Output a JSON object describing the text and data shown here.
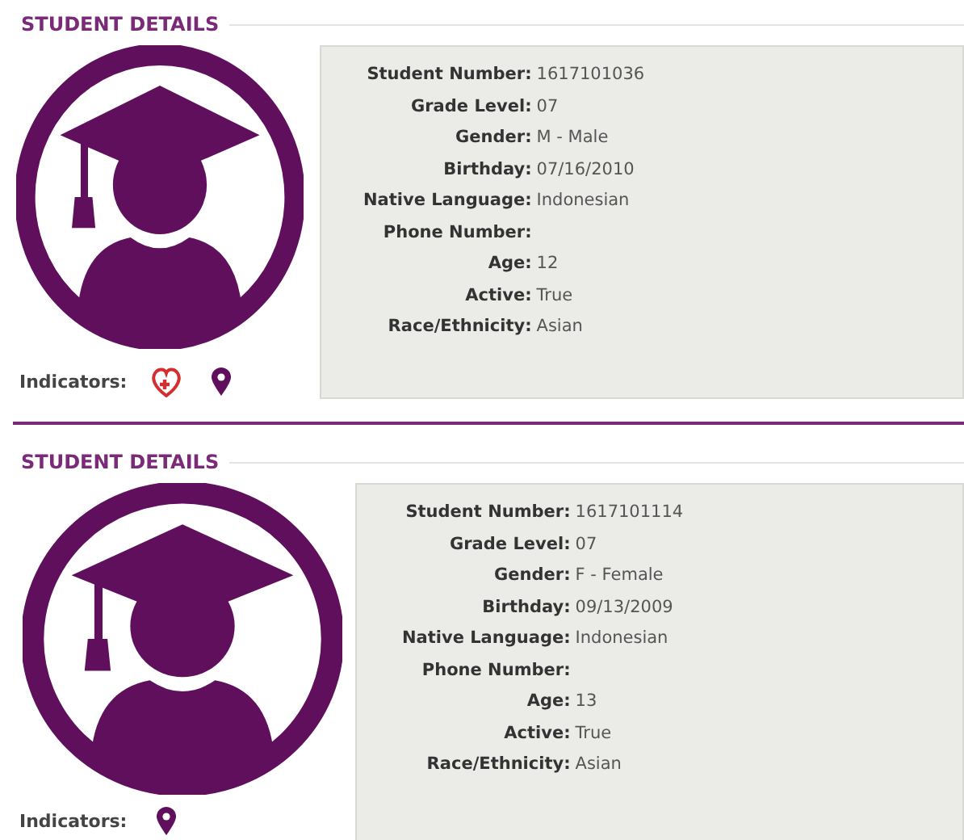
{
  "students": [
    {
      "title": "STUDENT DETAILS",
      "fields": [
        {
          "label": "Student Number:",
          "value": "1617101036"
        },
        {
          "label": "Grade Level:",
          "value": "07"
        },
        {
          "label": "Gender:",
          "value": "M - Male"
        },
        {
          "label": "Birthday:",
          "value": "07/16/2010"
        },
        {
          "label": "Native Language:",
          "value": "Indonesian"
        },
        {
          "label": "Phone Number:"
        },
        {
          "label": "Age:",
          "value": "12"
        },
        {
          "label": "Active:",
          "value": "True"
        },
        {
          "label": "Race/Ethnicity:",
          "value": "Asian"
        }
      ],
      "indicators_label": "Indicators:",
      "indicators": [
        {
          "kind": "health"
        },
        {
          "kind": "location"
        }
      ]
    },
    {
      "title": "STUDENT DETAILS",
      "fields": [
        {
          "label": "Student Number:",
          "value": "1617101114"
        },
        {
          "label": "Grade Level:",
          "value": "07"
        },
        {
          "label": "Gender:",
          "value": "F - Female"
        },
        {
          "label": "Birthday:",
          "value": "09/13/2009"
        },
        {
          "label": "Native Language:",
          "value": "Indonesian"
        },
        {
          "label": "Phone Number:"
        },
        {
          "label": "Age:",
          "value": "13"
        },
        {
          "label": "Active:",
          "value": "True"
        },
        {
          "label": "Race/Ethnicity:",
          "value": "Asian"
        }
      ],
      "indicators_label": "Indicators:",
      "indicators": [
        {
          "kind": "location"
        }
      ]
    }
  ]
}
